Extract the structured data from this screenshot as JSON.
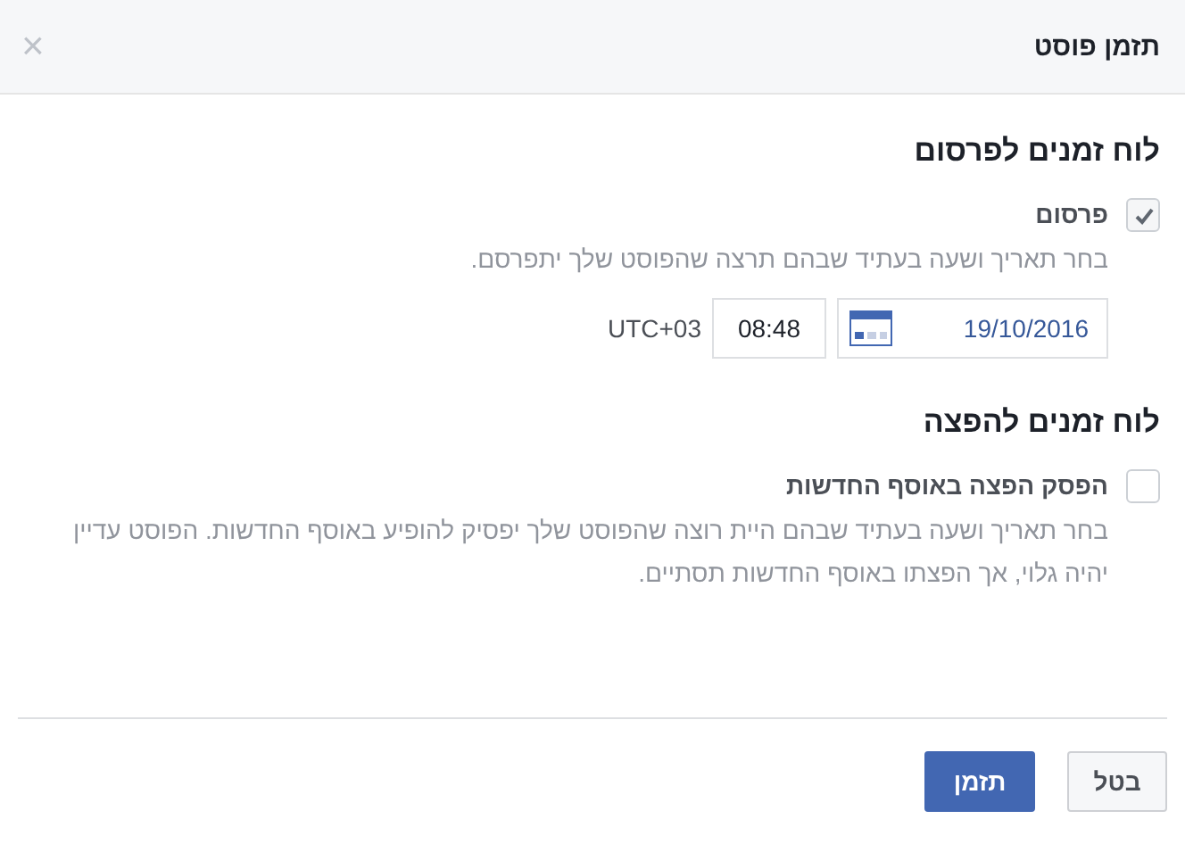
{
  "dialog": {
    "title": "תזמן פוסט",
    "close": "×"
  },
  "sections": [
    {
      "heading": "לוח זמנים לפרסום",
      "option": {
        "label": "פרסום",
        "checked": true,
        "description": "בחר תאריך ושעה בעתיד שבהם תרצה שהפוסט שלך יתפרסם."
      },
      "schedule": {
        "date": "19/10/2016",
        "time": "08:48",
        "timezone": "UTC+03"
      }
    },
    {
      "heading": "לוח זמנים להפצה",
      "option": {
        "label": "הפסק הפצה באוסף החדשות",
        "checked": false,
        "description": "בחר תאריך ושעה בעתיד שבהם היית רוצה שהפוסט שלך יפסיק להופיע באוסף החדשות. הפוסט עדיין יהיה גלוי, אך הפצתו באוסף החדשות תסתיים."
      }
    }
  ],
  "buttons": [
    {
      "label": "בטל",
      "kind": "secondary"
    },
    {
      "label": "תזמן",
      "kind": "primary"
    }
  ]
}
